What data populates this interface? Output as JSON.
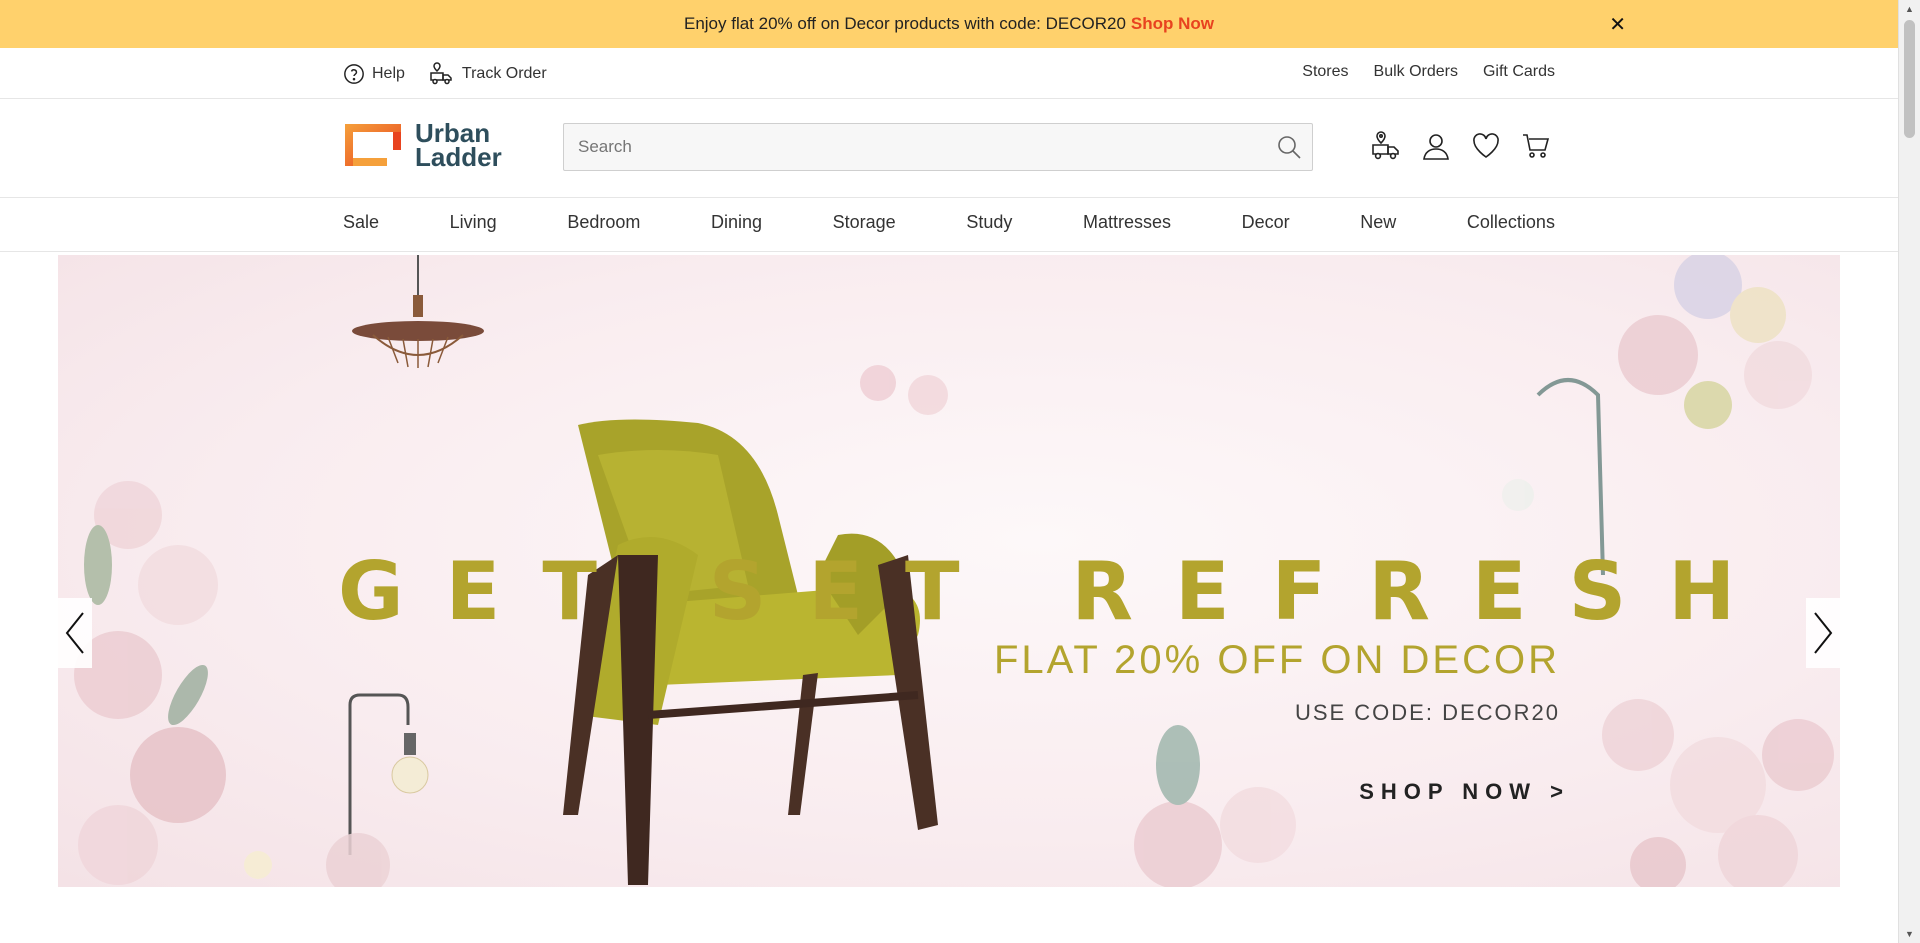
{
  "promo": {
    "text": "Enjoy flat 20% off on Decor products with code: DECOR20",
    "link": "Shop Now",
    "close": "✕"
  },
  "utility": {
    "left": [
      {
        "label": "Help",
        "icon": "help-circle-icon"
      },
      {
        "label": "Track Order",
        "icon": "truck-icon"
      }
    ],
    "right": [
      "Stores",
      "Bulk Orders",
      "Gift Cards"
    ]
  },
  "logo": {
    "line1": "Urban",
    "line2": "Ladder"
  },
  "search": {
    "placeholder": "Search"
  },
  "header_icons": [
    "store-locator-icon",
    "account-icon",
    "wishlist-icon",
    "cart-icon"
  ],
  "nav": [
    "Sale",
    "Living",
    "Bedroom",
    "Dining",
    "Storage",
    "Study",
    "Mattresses",
    "Decor",
    "New",
    "Collections"
  ],
  "hero": {
    "title": "GET SET REFRESH",
    "subtitle": "FLAT 20% OFF ON DECOR",
    "code": "USE CODE: DECOR20",
    "cta": "SHOP NOW >"
  },
  "colors": {
    "promo_bg": "#ffd16c",
    "promo_link": "#e8431f",
    "brand_orange": "#f07b2b",
    "brand_text": "#2e4e5c",
    "hero_gold": "#b3a42e"
  }
}
